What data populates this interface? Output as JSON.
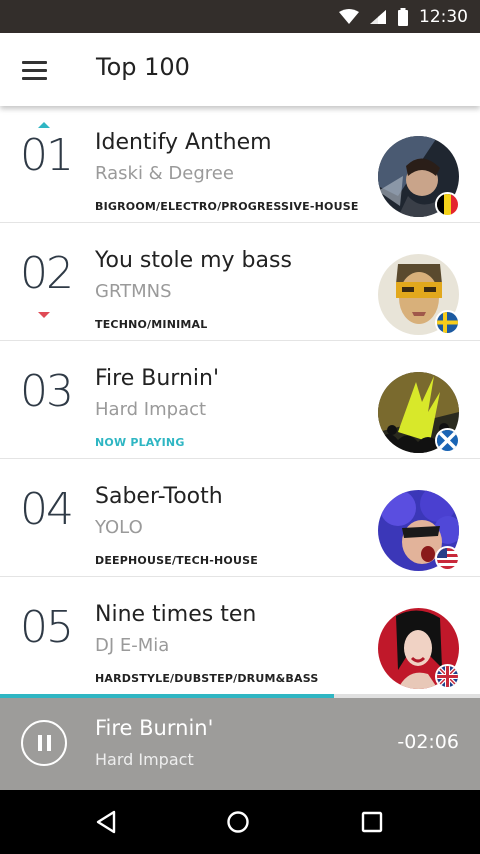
{
  "status_bar": {
    "time": "12:30",
    "icons": [
      "wifi-icon",
      "signal-icon",
      "battery-icon"
    ]
  },
  "app_bar": {
    "title": "Top 100",
    "menu_icon": "hamburger-menu-icon"
  },
  "colors": {
    "accent": "#2fb6c3",
    "trend_down": "#e04a55",
    "player_bg": "#9d9c9a",
    "status_bg": "#332e2b"
  },
  "tracks": [
    {
      "rank": "01",
      "trend": "up",
      "title": "Identify Anthem",
      "artist": "Raski & Degree",
      "genre": "BIGROOM/ELECTRO/PROGRESSIVE-HOUSE",
      "flag": "belgium-flag-icon"
    },
    {
      "rank": "02",
      "trend": "down",
      "title": "You stole my bass",
      "artist": "GRTMNS",
      "genre": "TECHNO/MINIMAL",
      "flag": "sweden-flag-icon"
    },
    {
      "rank": "03",
      "trend": "none",
      "title": "Fire Burnin'",
      "artist": "Hard Impact",
      "genre": "NOW PLAYING",
      "flag": "scotland-flag-icon"
    },
    {
      "rank": "04",
      "trend": "none",
      "title": "Saber-Tooth",
      "artist": "YOLO",
      "genre": "DEEPHOUSE/TECH-HOUSE",
      "flag": "usa-flag-icon"
    },
    {
      "rank": "05",
      "trend": "none",
      "title": "Nine times ten",
      "artist": "DJ E-Mia",
      "genre": "HARDSTYLE/DUBSTEP/DRUM&BASS",
      "flag": "uk-flag-icon"
    }
  ],
  "player": {
    "title": "Fire Burnin'",
    "artist": "Hard Impact",
    "time_remaining": "-02:06",
    "progress": 0.695,
    "pause_icon": "pause-icon"
  },
  "nav_bar": {
    "icons": [
      "back-icon",
      "home-icon",
      "recents-icon"
    ]
  }
}
